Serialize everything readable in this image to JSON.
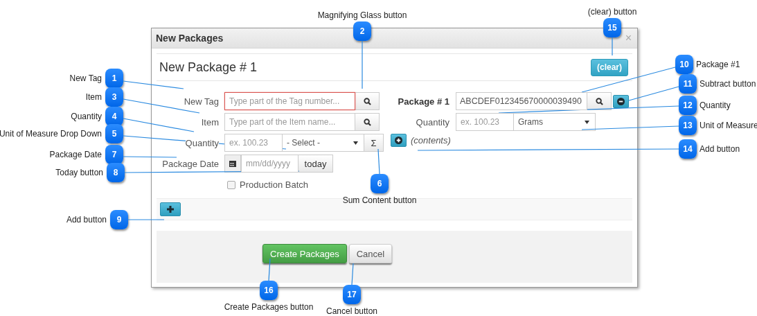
{
  "dialog": {
    "title": "New Packages",
    "close": "×",
    "heading": "New Package # 1",
    "clear_button": "(clear)",
    "left_form": {
      "tag": {
        "label": "New Tag",
        "placeholder": "Type part of the Tag number...",
        "invalid": true
      },
      "item": {
        "label": "Item",
        "placeholder": "Type part of the Item name..."
      },
      "quantity": {
        "label": "Quantity",
        "placeholder": "ex. 100.23",
        "unit": "- Select -",
        "sum_button": "Σ"
      },
      "date": {
        "label": "Package Date",
        "placeholder": "mm/dd/yyyy",
        "today_button": "today"
      },
      "production_batch": {
        "label": "Production Batch",
        "checked": false
      }
    },
    "right_form": {
      "package": {
        "label": "Package # 1",
        "value": "ABCDEF012345670000039490"
      },
      "quantity": {
        "label": "Quantity",
        "placeholder": "ex. 100.23",
        "unit": "Grams"
      },
      "contents": "(contents)"
    },
    "footer": {
      "create_button": "Create Packages",
      "cancel_button": "Cancel"
    }
  },
  "callouts": [
    {
      "number": "1",
      "label": "New Tag"
    },
    {
      "number": "2",
      "label": "Magnifying Glass button"
    },
    {
      "number": "3",
      "label": "Item"
    },
    {
      "number": "4",
      "label": "Quantity"
    },
    {
      "number": "5",
      "label": "Unit of Measure Drop Down"
    },
    {
      "number": "6",
      "label": "Sum Content button"
    },
    {
      "number": "7",
      "label": "Package Date"
    },
    {
      "number": "8",
      "label": "Today button"
    },
    {
      "number": "9",
      "label": "Add button"
    },
    {
      "number": "10",
      "label": "Package #1"
    },
    {
      "number": "11",
      "label": "Subtract button"
    },
    {
      "number": "12",
      "label": "Quantity"
    },
    {
      "number": "13",
      "label": "Unit of Measure"
    },
    {
      "number": "14",
      "label": "Add button"
    },
    {
      "number": "15",
      "label": "(clear) button"
    },
    {
      "number": "16",
      "label": "Create Packages button"
    },
    {
      "number": "17",
      "label": "Cancel button"
    }
  ]
}
